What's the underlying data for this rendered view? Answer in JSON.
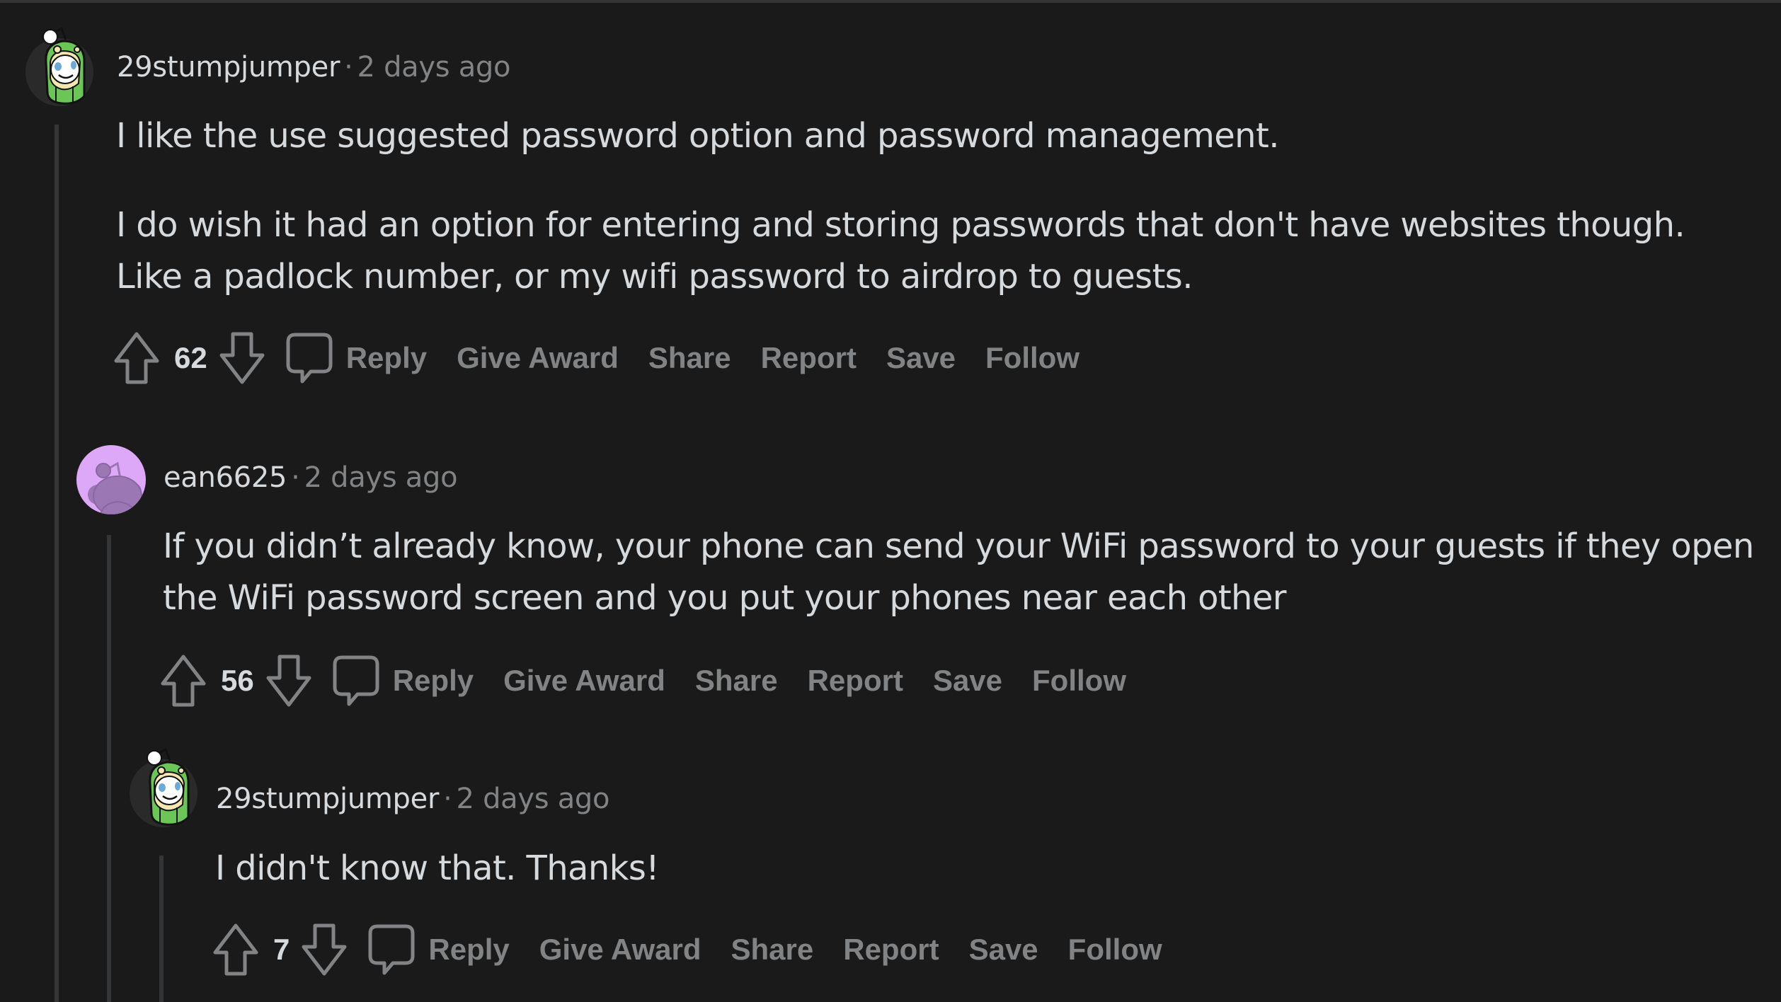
{
  "theme": {
    "background": "#1a1a1b",
    "thread_line": "#343536",
    "text_primary": "#d7dadc",
    "text_secondary": "#818384",
    "avatar_purple": "#dda8f7"
  },
  "comments": [
    {
      "username": "29stumpjumper",
      "separator": "·",
      "time": "2 days ago",
      "avatar": "snoo-frog-costume-avatar",
      "body": [
        "I like the use suggested password option and password management.",
        "I do wish it had an option for entering and storing passwords that don't have websites though. Like a padlock number, or my wifi password to airdrop to guests."
      ],
      "score": "62",
      "actions": [
        "Reply",
        "Give Award",
        "Share",
        "Report",
        "Save",
        "Follow"
      ]
    },
    {
      "username": "ean6625",
      "separator": "·",
      "time": "2 days ago",
      "avatar": "default-snoo-purple-avatar",
      "body": [
        "If you didn’t already know, your phone can send your WiFi password to your guests if they open the WiFi password screen and you put your phones near each other"
      ],
      "score": "56",
      "actions": [
        "Reply",
        "Give Award",
        "Share",
        "Report",
        "Save",
        "Follow"
      ]
    },
    {
      "username": "29stumpjumper",
      "separator": "·",
      "time": "2 days ago",
      "avatar": "snoo-frog-costume-avatar",
      "body": [
        "I didn't know that. Thanks!"
      ],
      "score": "7",
      "actions": [
        "Reply",
        "Give Award",
        "Share",
        "Report",
        "Save",
        "Follow"
      ]
    }
  ]
}
